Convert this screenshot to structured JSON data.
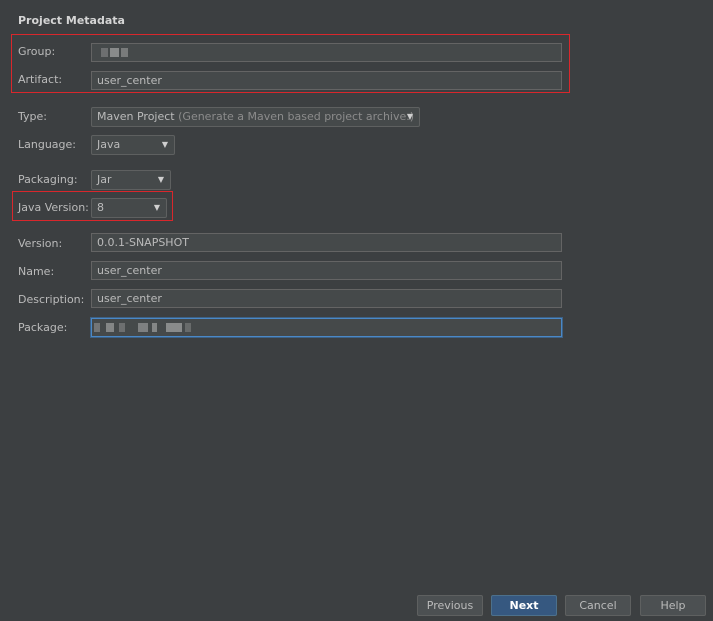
{
  "section": {
    "title": "Project Metadata"
  },
  "form": {
    "group": {
      "label": "Group:",
      "value": ""
    },
    "artifact": {
      "label": "Artifact:",
      "value": "user_center"
    },
    "type": {
      "label": "Type:",
      "selected": "Maven Project",
      "hint": "(Generate a Maven based project archive.)"
    },
    "language": {
      "label": "Language:",
      "selected": "Java"
    },
    "packaging": {
      "label": "Packaging:",
      "selected": "Jar"
    },
    "java_version": {
      "label": "Java Version:",
      "selected": "8"
    },
    "version": {
      "label": "Version:",
      "value": "0.0.1-SNAPSHOT"
    },
    "name": {
      "label": "Name:",
      "value": "user_center"
    },
    "description": {
      "label": "Description:",
      "value": "user_center"
    },
    "package": {
      "label": "Package:",
      "value": ""
    }
  },
  "buttons": {
    "previous": "Previous",
    "next": "Next",
    "cancel": "Cancel",
    "help": "Help"
  },
  "icons": {
    "dropdown": "chevron-down-icon"
  },
  "colors": {
    "background": "#3c3f41",
    "field_bg": "#45494a",
    "highlight_box": "#d9272c",
    "primary_button": "#365880",
    "focus_border": "#4a88c7"
  }
}
